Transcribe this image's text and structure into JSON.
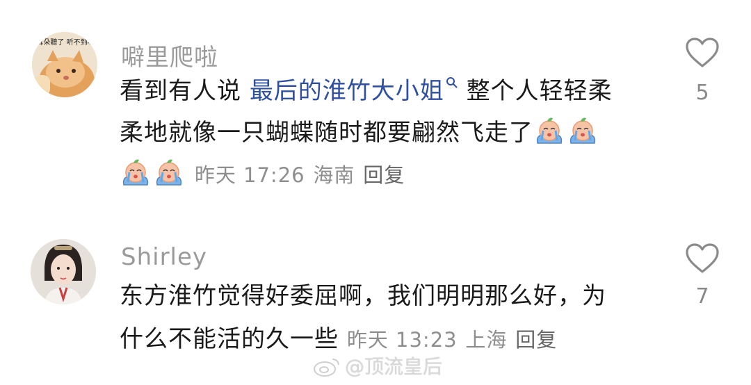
{
  "comments": [
    {
      "username": "噼里爬啦",
      "avatar_caption": "耳朵聽了 听不到哟",
      "text_before_mention": "看到有人说 ",
      "mention": "最后的淮竹大小姐",
      "text_line1_after": " 整个人轻轻柔",
      "text_line2": "柔地就像一只蝴蝶随时都要翩然飞走了",
      "time": "昨天 17:26",
      "location": "海南",
      "reply_label": "回复",
      "like_count": "5"
    },
    {
      "username": "Shirley",
      "text_line1": "东方淮竹觉得好委屈啊，我们明明那么好，为",
      "text_line2": "什么不能活的久一些",
      "time": "昨天 13:23",
      "location": "上海",
      "reply_label": "回复",
      "like_count": "7"
    }
  ],
  "watermark": "@顶流皇后",
  "icons": {
    "like": "heart-outline-icon",
    "emoji": "crying-peach-emoji",
    "search": "search-icon",
    "watermark": "weibo-logo-icon"
  },
  "colors": {
    "mention": "#2f4fa0",
    "username": "#9a9a9a",
    "meta": "#8e8e8e"
  }
}
